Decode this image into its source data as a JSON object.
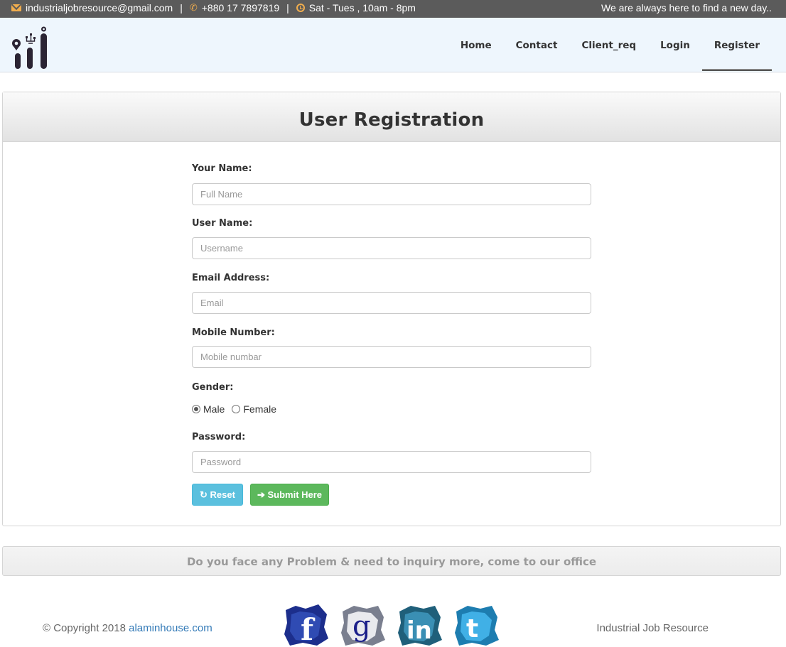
{
  "topbar": {
    "email": "industrialjobresource@gmail.com",
    "phone": "+880 17 7897819",
    "hours": "Sat - Tues , 10am - 8pm",
    "separator": "|",
    "tagline": "We are always here to find a new day.."
  },
  "nav": {
    "items": [
      {
        "label": "Home"
      },
      {
        "label": "Contact"
      },
      {
        "label": "Client_req"
      },
      {
        "label": "Login"
      },
      {
        "label": "Register"
      }
    ],
    "active": "Register"
  },
  "form": {
    "title": "User Registration",
    "name_label": "Your Name:",
    "name_placeholder": "Full Name",
    "username_label": "User Name:",
    "username_placeholder": "Username",
    "email_label": "Email Address:",
    "email_placeholder": "Email",
    "mobile_label": "Mobile Number:",
    "mobile_placeholder": "Mobile numbar",
    "gender_label": "Gender:",
    "gender_options": [
      "Male",
      "Female"
    ],
    "gender_selected": "Male",
    "password_label": "Password:",
    "password_placeholder": "Password",
    "reset_label": "Reset",
    "submit_label": "Submit Here"
  },
  "strip": {
    "text": "Do you face any Problem & need to inquiry more, come to our office"
  },
  "footer": {
    "copyright": "© Copyright 2018",
    "site_link": "alaminhouse.com",
    "brand": "Industrial Job Resource",
    "social": [
      "facebook-icon",
      "google-icon",
      "linkedin-icon",
      "twitter-icon"
    ]
  },
  "colors": {
    "topbar_bg": "#5b5b5b",
    "accent_orange": "#f0ad4e",
    "navbar_bg": "#eef6fd",
    "reset_btn": "#5bc0de",
    "submit_btn": "#5cb85c",
    "link": "#337ab7"
  }
}
